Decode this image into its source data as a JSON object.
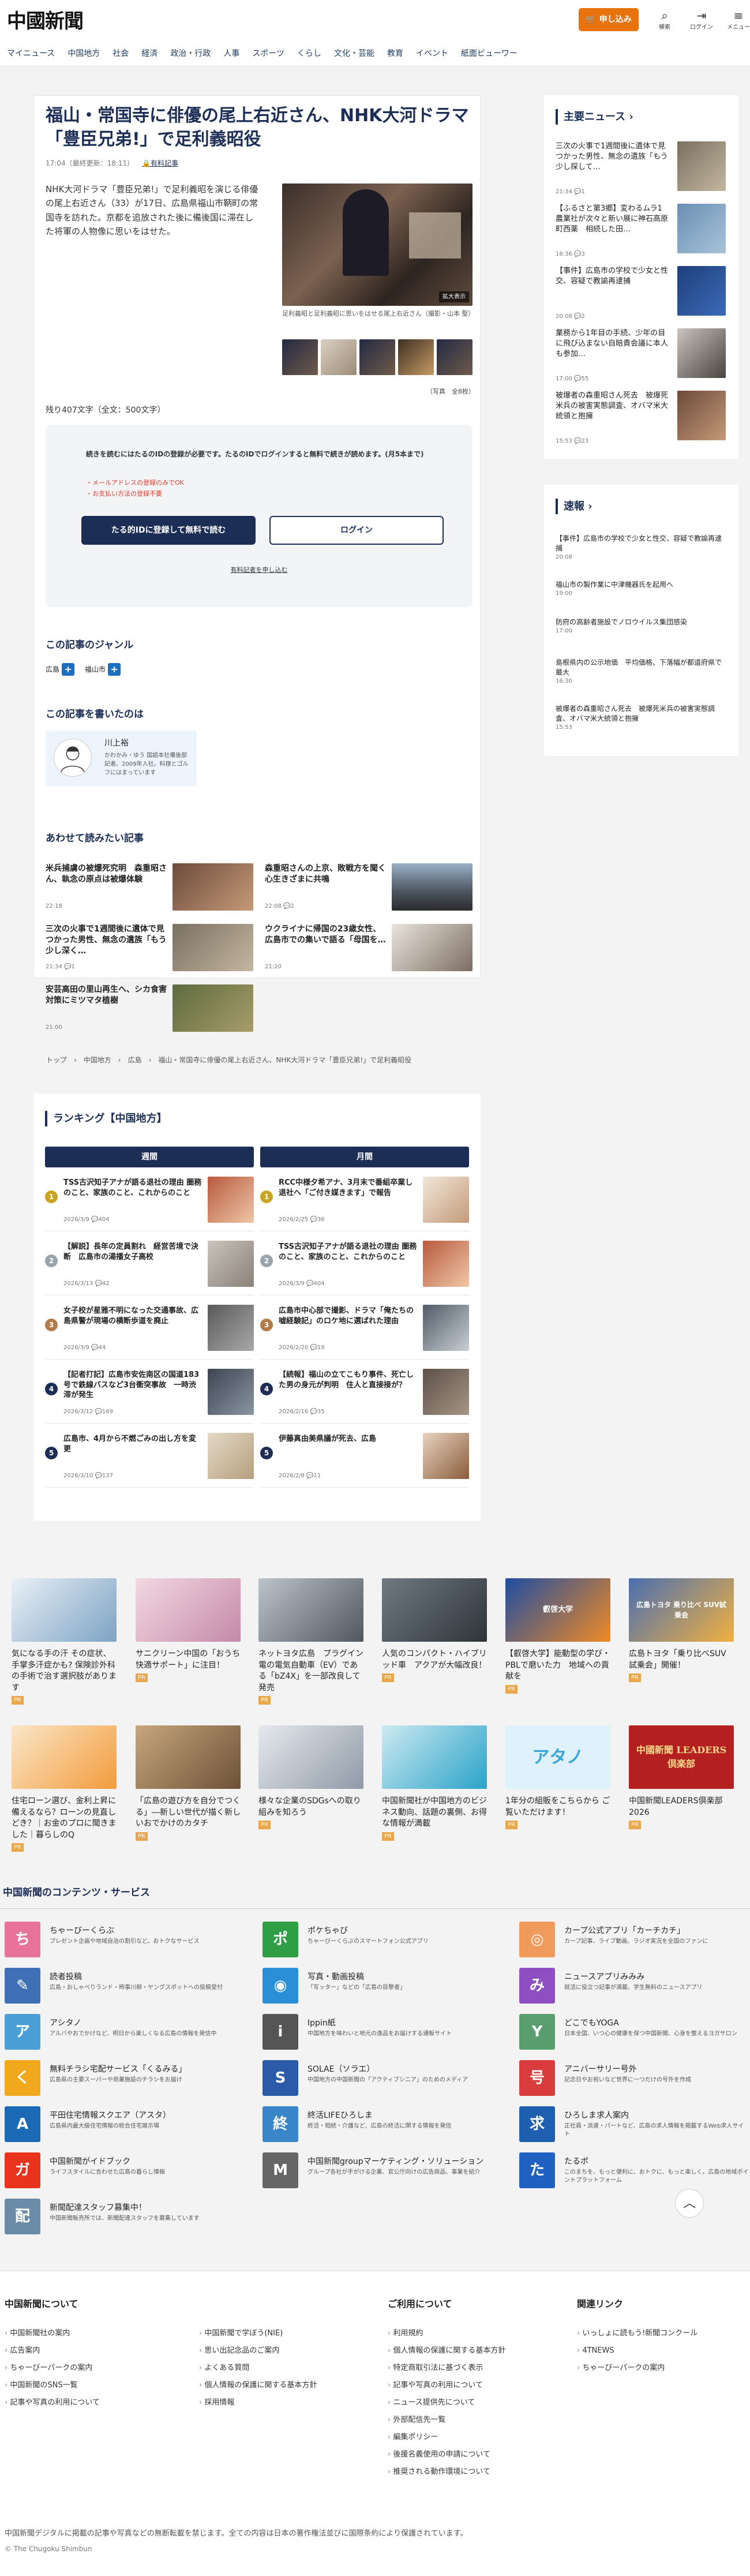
{
  "header": {
    "logo": "中國新聞",
    "subscribe": "申し込み",
    "icons": [
      {
        "icon": "search-icon",
        "label": "検索"
      },
      {
        "icon": "login-icon",
        "label": "ログイン"
      },
      {
        "icon": "menu-icon",
        "label": "メニュー"
      }
    ],
    "nav": [
      "マイニュース",
      "中国地方",
      "社会",
      "経済",
      "政治・行政",
      "人事",
      "スポーツ",
      "くらし",
      "文化・芸能",
      "教育",
      "イベント",
      "紙面ビューワー"
    ]
  },
  "article": {
    "headline": "福山・常国寺に俳優の尾上右近さん、NHK大河ドラマ「豊臣兄弟!」で足利義昭役",
    "time": "17:04（最終更新：18:11）",
    "tag": "有料記事",
    "lead": "NHK大河ドラマ「豊臣兄弟!」で足利義昭を演じる俳優の尾上右近さん（33）が17日、広島県福山市鞆町の常国寺を訪れた。京都を追放された後に備後国に滞在した将軍の人物像に思いをはせた。",
    "hero_badge": "拡大表示",
    "caption": "足利義昭と足利義昭に思いをはせる尾上右近さん（撮影・山本 堅）",
    "photo_count": "（写真　全8枚）",
    "char_count": "残り407文字（全文：500文字）",
    "paywall": {
      "text": "続きを読むにはたるのIDの登録が必要です。たるのIDでログインすると無料で続きが読めます。(月5本まで)",
      "notes": [
        "・メールアドレスの登録のみでOK",
        "・お支払い方法の登録不要"
      ],
      "register": "たる的IDに登録して無料で読む",
      "login": "ログイン",
      "paid_link": "有料記者を申し込む"
    },
    "genre_title": "この記事のジャンル",
    "genres": [
      "広島",
      "福山市"
    ],
    "author_title": "この記事を書いたのは",
    "author_name": "川上裕",
    "author_kana": "かわかみ・ゆう",
    "author_desc": "国語本社備後部記者。2009年入社。料理とゴルフにはまっています",
    "related_title": "あわせて読みたい記事",
    "related": [
      {
        "title": "米兵捕虜の被爆死究明　森重昭さん、執念の原点は被爆体験",
        "date": "22:18"
      },
      {
        "title": "森重昭さんの上京、敗戦方を聞く心生きざまに共鳴",
        "date": "22:08 💬2"
      },
      {
        "title": "三次の火事で1週間後に遺体で見つかった男性、無念の遺族「もう少し深く…",
        "date": "21:34 💬1"
      },
      {
        "title": "ウクライナに帰国の23歳女性、広島市での集いで語る「母国を…",
        "date": "21:20"
      },
      {
        "title": "安芸高田の里山再生へ、シカ食害対策にミツマタ植樹",
        "date": "21:00"
      }
    ],
    "breadcrumb": "トップ　›　中国地方　›　広島　›　福山・常国寺に俳優の尾上右近さん、NHK大河ドラマ「豊臣兄弟!」で足利義昭役"
  },
  "ranking": {
    "title": "ランキング【中国地方】",
    "weekly_label": "週間",
    "monthly_label": "月間",
    "weekly": [
      {
        "title": "TSS古沢知子アナが語る退社の理由 圏務のこと、家族のこと、これからのこと",
        "date": "2026/3/9 💬404"
      },
      {
        "title": "【解説】長年の定員割れ　経営苦境で決断　広島市の湯播女子高校",
        "date": "2026/3/13 💬42"
      },
      {
        "title": "女子校が星雅不明になった交通事故、広島県警が現場の横断歩道を廃止",
        "date": "2026/3/9 💬44"
      },
      {
        "title": "【記者打記】広島市安佐南区の国道183号で鉄線バスなど3台衝突事故　一時渋滞が発生",
        "date": "2026/3/12 💬169"
      },
      {
        "title": "広島市、4月から不燃ごみの出し方を変更",
        "date": "2026/3/10 💬137"
      }
    ],
    "monthly": [
      {
        "title": "RCC中様夕希アナ、3月末で番組卒業し退社へ「ご付き媒きます」で報告",
        "date": "2026/2/25 💬36"
      },
      {
        "title": "TSS古沢知子アナが語る退社の理由 圏務のこと、家族のこと、これからのこと",
        "date": "2026/3/9 💬404"
      },
      {
        "title": "広島市中心部で撮影、ドラマ「俺たちの嘘経験記」のロケ地に選ばれた理由",
        "date": "2026/2/20 💬19"
      },
      {
        "title": "【続報】福山の立てこもり事件、死亡した男の身元が判明　住人と直接接が？",
        "date": "2026/2/16 💬35"
      },
      {
        "title": "伊藤真由美県議が死去、広島",
        "date": "2026/2/8 💬11"
      }
    ]
  },
  "sidebar": {
    "main_news_title": "主要ニュース",
    "main_news": [
      {
        "title": "三次の火事で1週間後に遺体で見つかった男性、無念の遺族「もう少し探して…",
        "date": "21:34 💬1"
      },
      {
        "title": "【ふるさと第3郷】変わるムラ1 農業社が次々と新い展に神石高原町西薬　相続した田…",
        "date": "18:36 💬3"
      },
      {
        "title": "【事件】広島市の学校で少女と性交、容疑で教諭再逮捕",
        "date": "20:08 💬2"
      },
      {
        "title": "業務から1年目の手続、少年の目に飛び込まない自賠責会議に本人も参加…",
        "date": "17:00 💬55"
      },
      {
        "title": "被爆者の森重昭さん死去　被爆死米兵の被害実態調査、オバマ米大統領と抱擁",
        "date": "15:53 💬23"
      }
    ],
    "breaking_title": "速報",
    "breaking": [
      {
        "title": "【事件】広島市の学校で少女と性交、容疑で教諭再逮捕",
        "date": "20:08"
      },
      {
        "title": "福山市の製作業に中津機器氏を起用へ",
        "date": "19:00"
      },
      {
        "title": "防府の高齢者施設でノロウイルス集団感染",
        "date": "17:00"
      },
      {
        "title": "島根県内の公示地価　平均価格、下落幅が都道府県で最大",
        "date": "16:30"
      },
      {
        "title": "被爆者の森重昭さん死去　被爆死米兵の被害実態調査、オバマ米大統領と抱擁",
        "date": "15:53"
      }
    ]
  },
  "ads": [
    {
      "text": "気になる手の汗 その症状、手掌多汗症かも? 保険診外科の手術で治す選択肢があります",
      "pr": "PR"
    },
    {
      "text": "サニクリーン中国の「おうち快適サポート」に注目！",
      "pr": "PR"
    },
    {
      "text": "ネットヨタ広島　プラグイン電の電気自動車（EV）である「bZ4X」を一部改良して発売",
      "pr": "PR"
    },
    {
      "text": "人気のコンパクト・ハイブリッド車　アクアが大幅改良！",
      "pr": "PR"
    },
    {
      "text": "【叡啓大学】能動型の学び・PBLで磨いた力　地域への貢献を",
      "pr": "PR"
    },
    {
      "text": "広島トヨタ「乗り比べSUV試乗会」開催！",
      "pr": "PR"
    },
    {
      "text": "住宅ローン選び、金利上昇に備えるなら？ローンの見直しどき？｜お金のプロに聞きました｜暮らしのQ",
      "pr": "PR"
    },
    {
      "text": "「広島の遊び方を自分でつくる」―新しい世代が描く新しいおでかけのカタチ",
      "pr": "PR"
    },
    {
      "text": "様々な企業のSDGsへの取り組みを知ろう",
      "pr": "PR"
    },
    {
      "text": "中国新聞社が中国地方のビジネス動向、話題の裏側、お得な情報が満載",
      "pr": "PR"
    },
    {
      "text": "1年分の組販をこちらから ご覧いただけます！",
      "pr": "PR"
    },
    {
      "text": "中国新聞LEADERS倶楽部2026",
      "pr": "PR"
    }
  ],
  "ad_graphics": {
    "atano": "アタノ",
    "leaders": "中國新聞 LEADERS 倶楽部",
    "ikedaiten": "叡啓大学",
    "suv": "広島トヨタ 乗り比べ SUV試乗会"
  },
  "services": {
    "title": "中国新聞のコンテンツ・サービス",
    "items": [
      {
        "name": "ちゃーびーくらぶ",
        "desc": "プレゼント企画や地域自治の割引など。おトクなサービス",
        "color": "#e8739a",
        "glyph": "ち"
      },
      {
        "name": "ポケちゃび",
        "desc": "ちゃーびーくらぶのスマートフォン公式アプリ",
        "color": "#2f9e44",
        "glyph": "ポ"
      },
      {
        "name": "カープ公式アプリ「カーチカチ」",
        "desc": "カープ記事、ライブ動画、ラジオ実況を全国のファンに",
        "color": "#f09a5b",
        "glyph": "◎"
      },
      {
        "name": "読者投稿",
        "desc": "広島・おしゃべりランド・時事川柳・ヤングスポットへの投稿受付",
        "color": "#3f6fb5",
        "glyph": "✎"
      },
      {
        "name": "写真・動画投稿",
        "desc": "「写ッター」などの「広島の目撃者」",
        "color": "#2b8fd6",
        "glyph": "◉"
      },
      {
        "name": "ニュースアプリみみみ",
        "desc": "就活に役立つ記事が満載、学生無料のニュースアプリ",
        "color": "#8e4fc2",
        "glyph": "み"
      },
      {
        "name": "アシタノ",
        "desc": "アルバやおでかけなど、明日から楽しくなる広島の情報を発信中",
        "color": "#4aa0d6",
        "glyph": "ア"
      },
      {
        "name": "Ippin紙",
        "desc": "中国地方を味わいと地元の逸品をお届けする通販サイト",
        "color": "#555555",
        "glyph": "i"
      },
      {
        "name": "どこでもYOGA",
        "desc": "日本全国、いつ心の健康を保つ中国新聞、心身を整えるヨガサロン",
        "color": "#5a9e6f",
        "glyph": "Y"
      },
      {
        "name": "無料チラシ宅配サービス「くるみる」",
        "desc": "広島県の主要スーパーや商業施設のチラシをお届け",
        "color": "#f2a81d",
        "glyph": "く"
      },
      {
        "name": "SOLAE（ソラエ）",
        "desc": "中国地方の中国新聞の「アクティブシニア」のためのメディア",
        "color": "#2a5aa8",
        "glyph": "S"
      },
      {
        "name": "アニバーサリー号外",
        "desc": "記念日やお祝いなど世界に一つだけの号外を作成",
        "color": "#d83c3c",
        "glyph": "号"
      },
      {
        "name": "平田住宅情報スクエア（アスタ）",
        "desc": "広島県内最大級住宅情報の総合住宅展示場",
        "color": "#1b6ab5",
        "glyph": "A"
      },
      {
        "name": "終活LIFEひろしま",
        "desc": "終活・相続・介護など、広島の終活に関する情報を発信",
        "color": "#3a86c8",
        "glyph": "終"
      },
      {
        "name": "ひろしま求人案内",
        "desc": "正社員・派遣・パートなど、広島の求人情報を掲載するWeb求人サイト",
        "color": "#1e5fb0",
        "glyph": "求"
      },
      {
        "name": "中国新聞がイドブック",
        "desc": "ライフスタイルに合わせた広島の暮らし情報",
        "color": "#e8341c",
        "glyph": "ガ"
      },
      {
        "name": "中国新聞groupマーケティング・ソリューション",
        "desc": "グループ各社が手がける企業、官公庁向けの広告商品、事業を紹介",
        "color": "#666666",
        "glyph": "M"
      },
      {
        "name": "たるポ",
        "desc": "このまちを、もっと便利に、おトクに、もっと楽しく。広島の地域ポイントプラットフォーム",
        "color": "#2060c0",
        "glyph": "た"
      },
      {
        "name": "新聞配達スタッフ募集中！",
        "desc": "中国新聞販売所では、新聞配達スタッフを募集しています",
        "color": "#6b8ca8",
        "glyph": "配"
      }
    ]
  },
  "footer": {
    "cols": [
      {
        "title": "中国新聞について",
        "items": [
          "中国新聞社の案内",
          "広告案内",
          "ちゃーびーパークの案内",
          "中国新聞のSNS一覧",
          "記事や写真の利用について"
        ]
      },
      {
        "title": "",
        "items": [
          "中国新聞で学ぼう(NIE)",
          "思い出記念品のご案内",
          "よくある質問",
          "個人情報の保護に関する基本方針",
          "採用情報"
        ]
      },
      {
        "title": "ご利用について",
        "items": [
          "利用規約",
          "個人情報の保護に関する基本方針",
          "特定商取引法に基づく表示",
          "記事や写真の利用について",
          "ニュース提供先について",
          "外部配信先一覧",
          "編集ポリシー",
          "後援名義使用の申請について",
          "推奨される動作環境について"
        ]
      },
      {
        "title": "関連リンク",
        "items": [
          "いっしょに読もう!新聞コンクール",
          "4TNEWS",
          "ちゃーびーパークの案内"
        ]
      }
    ],
    "note": "中国新聞デジタルに掲載の記事や写真などの無断転載を禁じます。全ての内容は日本の著作権法並びに国際条約により保護されています。",
    "copyright": "© The Chugoku Shimbun"
  }
}
